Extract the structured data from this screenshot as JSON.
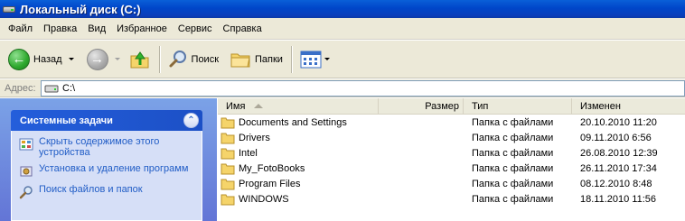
{
  "window": {
    "title": "Локальный диск (C:)",
    "title_icon": "drive-icon"
  },
  "menu": [
    "Файл",
    "Правка",
    "Вид",
    "Избранное",
    "Сервис",
    "Справка"
  ],
  "toolbar": {
    "back_label": "Назад",
    "search_label": "Поиск",
    "folders_label": "Папки"
  },
  "address": {
    "label": "Адрес:",
    "value": "C:\\"
  },
  "tasks": {
    "header": "Системные задачи",
    "items": [
      {
        "label": "Скрыть содержимое этого устройства",
        "icon": "hide-contents-icon"
      },
      {
        "label": "Установка и удаление программ",
        "icon": "add-remove-programs-icon"
      },
      {
        "label": "Поиск файлов и папок",
        "icon": "search-icon"
      }
    ]
  },
  "files": {
    "columns": {
      "name": "Имя",
      "size": "Размер",
      "type": "Тип",
      "modified": "Изменен"
    },
    "sort_column": "name",
    "rows": [
      {
        "name": "Documents and Settings",
        "size": "",
        "type": "Папка с файлами",
        "modified": "20.10.2010 11:20"
      },
      {
        "name": "Drivers",
        "size": "",
        "type": "Папка с файлами",
        "modified": "09.11.2010 6:56"
      },
      {
        "name": "Intel",
        "size": "",
        "type": "Папка с файлами",
        "modified": "26.08.2010 12:39"
      },
      {
        "name": "My_FotoBooks",
        "size": "",
        "type": "Папка с файлами",
        "modified": "26.11.2010 17:34"
      },
      {
        "name": "Program Files",
        "size": "",
        "type": "Папка с файлами",
        "modified": "08.12.2010 8:48"
      },
      {
        "name": "WINDOWS",
        "size": "",
        "type": "Папка с файлами",
        "modified": "18.11.2010 11:56"
      }
    ]
  },
  "colors": {
    "titlebar": "#0046c9",
    "chrome": "#ece9d8",
    "task_link": "#215dc6",
    "task_pane": "#6375d6"
  }
}
